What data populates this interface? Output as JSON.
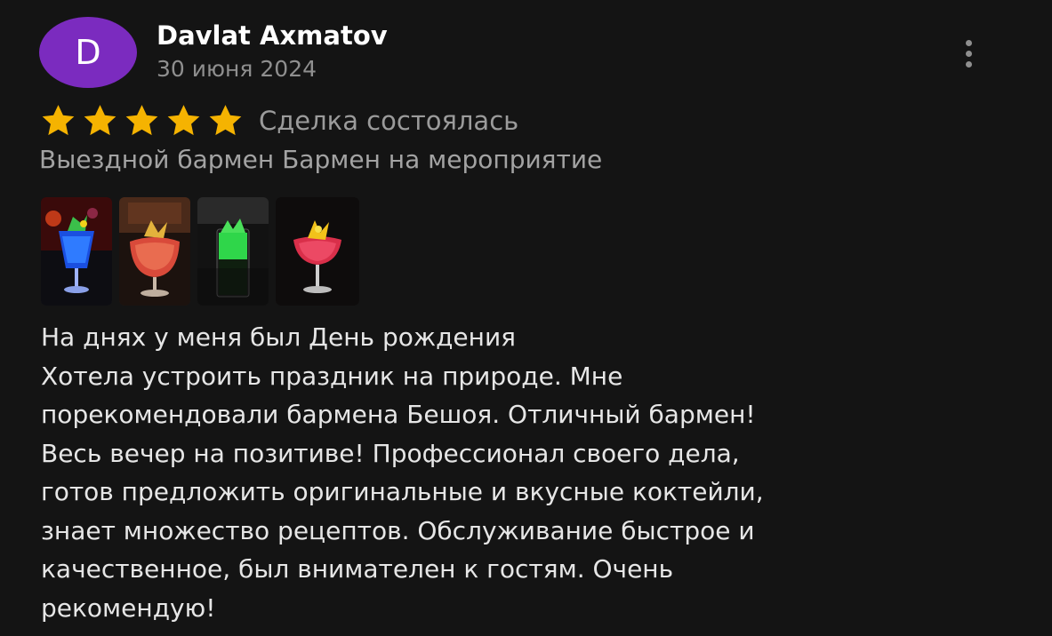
{
  "author": {
    "initial": "D",
    "name": "Davlat Axmatov",
    "date": "30 июня 2024",
    "avatar_color": "#7b2bbf"
  },
  "rating": {
    "value": 5,
    "max": 5,
    "star_color": "#f5b301",
    "deal_status": "Сделка состоялась"
  },
  "service": "Выездной бармен Бармен на мероприятие",
  "photos": [
    {
      "subject": "blue-cocktail"
    },
    {
      "subject": "red-cocktail"
    },
    {
      "subject": "green-cocktail"
    },
    {
      "subject": "pink-cocktail"
    }
  ],
  "review_text": [
    "На днях у меня был День рождения",
    "Хотела устроить праздник на природе. Мне",
    "порекомендовали бармена  Бешоя. Отличный бармен!",
    "Весь вечер на позитиве! Профессионал своего дела,",
    "готов предложить оригинальные и вкусные коктейли,",
    "знает множество рецептов. Обслуживание быстрое и",
    "качественное, был внимателен к гостям. Очень",
    "рекомендую!"
  ],
  "icons": {
    "more": "more-vertical-icon",
    "star": "star-icon"
  }
}
